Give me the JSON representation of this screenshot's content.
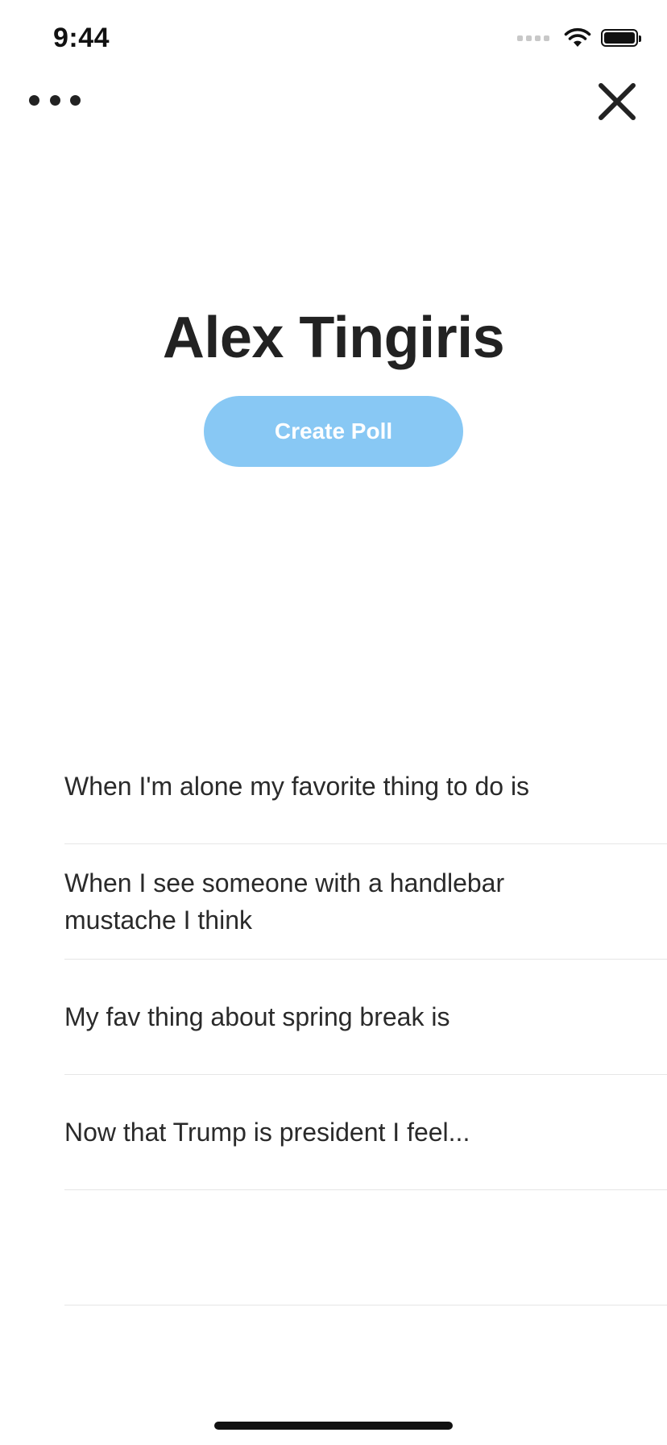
{
  "status_bar": {
    "time": "9:44"
  },
  "profile": {
    "name": "Alex Tingiris"
  },
  "actions": {
    "create_poll_label": "Create Poll"
  },
  "polls": [
    {
      "text": "When I'm alone my favorite thing to do is"
    },
    {
      "text": "When I see someone with a handlebar mustache I think"
    },
    {
      "text": "My fav thing about spring break is"
    },
    {
      "text": "Now that Trump is president I feel..."
    },
    {
      "text": ""
    }
  ],
  "icons": {
    "more": "more-horizontal-icon",
    "close": "close-icon",
    "wifi": "wifi-icon",
    "battery": "battery-icon",
    "signal": "cellular-signal-icon"
  },
  "colors": {
    "accent": "#88c8f4",
    "text": "#222222",
    "divider": "#e6e6e6",
    "background": "#ffffff"
  }
}
